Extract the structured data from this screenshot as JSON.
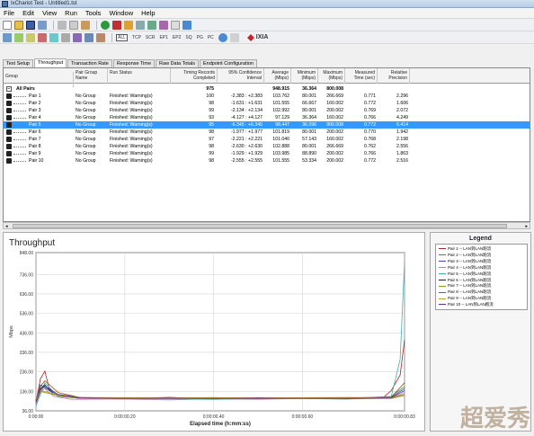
{
  "window": {
    "title": "IxChariot Test - Untitled1.tst"
  },
  "menu": [
    "File",
    "Edit",
    "View",
    "Run",
    "Tools",
    "Window",
    "Help"
  ],
  "toolbar2": {
    "protocols": [
      "ALL",
      "TCP",
      "SCR",
      "EP1",
      "EP2",
      "SQ",
      "PG",
      "PC"
    ],
    "brand": "IXIA"
  },
  "tabs": [
    "Test Setup",
    "Throughput",
    "Transaction Rate",
    "Response Time",
    "Raw Data Totals",
    "Endpoint Configuration"
  ],
  "grid": {
    "headers": {
      "group": "Group",
      "pair_group": "Pair Group Name",
      "run_status": "Run Status",
      "timing": "Timing Records Completed",
      "ci": "95% Confidence Interval",
      "avg": "Average (Mbps)",
      "min": "Minimum (Mbps)",
      "max": "Maximum (Mbps)",
      "time": "Measured Time (sec)",
      "precision": "Relative Precision"
    },
    "summary": {
      "label": "All Pairs",
      "timing": "975",
      "avg": "948.915",
      "min": "36.364",
      "max": "800.008"
    },
    "rows": [
      {
        "pair": "Pair 1",
        "group": "No Group",
        "status": "Finished: Warning(s)",
        "timing": "100",
        "ci": "-2.383 : +2.383",
        "avg": "103.762",
        "min": "80.001",
        "max": "266.669",
        "time": "0.771",
        "prec": "2.296"
      },
      {
        "pair": "Pair 2",
        "group": "No Group",
        "status": "Finished: Warning(s)",
        "timing": "98",
        "ci": "-1.631 : +1.631",
        "avg": "101.555",
        "min": "66.667",
        "max": "160.002",
        "time": "0.772",
        "prec": "1.606"
      },
      {
        "pair": "Pair 3",
        "group": "No Group",
        "status": "Finished: Warning(s)",
        "timing": "99",
        "ci": "-2.134 : +2.134",
        "avg": "102.992",
        "min": "80.001",
        "max": "200.002",
        "time": "0.769",
        "prec": "2.072"
      },
      {
        "pair": "Pair 4",
        "group": "No Group",
        "status": "Finished: Warning(s)",
        "timing": "93",
        "ci": "-4.127 : +4.127",
        "avg": "97.129",
        "min": "36.364",
        "max": "160.002",
        "time": "0.766",
        "prec": "4.249"
      },
      {
        "pair": "Pair 5",
        "group": "No Group",
        "status": "Finished: Warning(s)",
        "timing": "95",
        "ci": "-6.345 : +6.345",
        "avg": "98.447",
        "min": "36.096",
        "max": "800.008",
        "time": "0.772",
        "prec": "6.414"
      },
      {
        "pair": "Pair 6",
        "group": "No Group",
        "status": "Finished: Warning(s)",
        "timing": "98",
        "ci": "-1.977 : +1.977",
        "avg": "101.819",
        "min": "80.001",
        "max": "200.002",
        "time": "0.770",
        "prec": "1.942"
      },
      {
        "pair": "Pair 7",
        "group": "No Group",
        "status": "Finished: Warning(s)",
        "timing": "97",
        "ci": "-2.221 : +2.221",
        "avg": "101.040",
        "min": "57.143",
        "max": "160.002",
        "time": "0.768",
        "prec": "2.198"
      },
      {
        "pair": "Pair 8",
        "group": "No Group",
        "status": "Finished: Warning(s)",
        "timing": "98",
        "ci": "-2.630 : +2.630",
        "avg": "102.888",
        "min": "80.001",
        "max": "266.669",
        "time": "0.762",
        "prec": "2.556"
      },
      {
        "pair": "Pair 9",
        "group": "No Group",
        "status": "Finished: Warning(s)",
        "timing": "99",
        "ci": "-1.929 : +1.929",
        "avg": "103.985",
        "min": "88.890",
        "max": "200.002",
        "time": "0.766",
        "prec": "1.863"
      },
      {
        "pair": "Pair 10",
        "group": "No Group",
        "status": "Finished: Warning(s)",
        "timing": "98",
        "ci": "-2.555 : +2.555",
        "avg": "101.555",
        "min": "53.334",
        "max": "200.002",
        "time": "0.772",
        "prec": "2.516"
      }
    ],
    "selected_index": 4
  },
  "legend": {
    "title": "Legend",
    "items": [
      {
        "label": "Pair 1 -- LAN到LAN跑流",
        "color": "#b02020"
      },
      {
        "label": "Pair 2 -- LAN到LAN跑流",
        "color": "#20a040"
      },
      {
        "label": "Pair 3 -- LAN到LAN跑流",
        "color": "#3050c0"
      },
      {
        "label": "Pair 4 -- LAN到LAN跑流",
        "color": "#c080c0"
      },
      {
        "label": "Pair 5 -- LAN到LAN跑流",
        "color": "#40b0b0"
      },
      {
        "label": "Pair 6 -- LAN到LAN跑流",
        "color": "#202020"
      },
      {
        "label": "Pair 7 -- LAN到LAN跑流",
        "color": "#80a020"
      },
      {
        "label": "Pair 8 -- LAN到LAN跑流",
        "color": "#a05020"
      },
      {
        "label": "Pair 9 -- LAN到LAN跑流",
        "color": "#c0a020"
      },
      {
        "label": "Pair 10 -- LAN到LAN跑流",
        "color": "#6a2a9a"
      }
    ]
  },
  "chart_data": {
    "type": "line",
    "title": "Throughput",
    "xlabel": "Elapsed time (h:mm:ss)",
    "ylabel": "Mbps",
    "ylim": [
      36.0,
      848.0
    ],
    "yticks": [
      "36.00",
      "136.00",
      "236.00",
      "336.00",
      "436.00",
      "536.00",
      "636.00",
      "736.00",
      "848.00"
    ],
    "ytick_values": [
      36,
      136,
      236,
      336,
      436,
      536,
      636,
      736,
      848
    ],
    "xticks": [
      "0:00:00",
      "0:00:00.20",
      "0:00:00.40",
      "0:00:00.60",
      "0:00:00.83"
    ],
    "xtick_values": [
      0,
      0.2,
      0.4,
      0.6,
      0.83
    ],
    "xlim": [
      0,
      0.83
    ],
    "grid": true,
    "series": [
      {
        "name": "Pair 1 -- LAN到LAN跑流",
        "color": "#b02020",
        "x": [
          0,
          0.01,
          0.02,
          0.03,
          0.05,
          0.1,
          0.2,
          0.3,
          0.4,
          0.5,
          0.6,
          0.7,
          0.78,
          0.8,
          0.82,
          0.83
        ],
        "y": [
          80,
          200,
          240,
          150,
          110,
          100,
          100,
          105,
          98,
          102,
          100,
          99,
          100,
          140,
          220,
          400
        ]
      },
      {
        "name": "Pair 2 -- LAN到LAN跑流",
        "color": "#20a040",
        "x": [
          0,
          0.01,
          0.02,
          0.04,
          0.06,
          0.1,
          0.2,
          0.3,
          0.4,
          0.5,
          0.6,
          0.7,
          0.8,
          0.83
        ],
        "y": [
          80,
          140,
          160,
          130,
          110,
          100,
          97,
          104,
          101,
          99,
          103,
          100,
          110,
          160
        ]
      },
      {
        "name": "Pair 3 -- LAN到LAN跑流",
        "color": "#3050c0",
        "x": [
          0,
          0.01,
          0.03,
          0.05,
          0.1,
          0.2,
          0.3,
          0.4,
          0.5,
          0.6,
          0.7,
          0.8,
          0.83
        ],
        "y": [
          90,
          170,
          140,
          120,
          105,
          100,
          102,
          99,
          104,
          100,
          98,
          105,
          150
        ]
      },
      {
        "name": "Pair 4 -- LAN到LAN跑流",
        "color": "#c080c0",
        "x": [
          0,
          0.01,
          0.02,
          0.04,
          0.08,
          0.2,
          0.3,
          0.4,
          0.5,
          0.6,
          0.7,
          0.8,
          0.83
        ],
        "y": [
          70,
          130,
          150,
          110,
          95,
          96,
          92,
          98,
          95,
          99,
          97,
          100,
          130
        ]
      },
      {
        "name": "Pair 5 -- LAN到LAN跑流",
        "color": "#40b0b0",
        "x": [
          0,
          0.01,
          0.02,
          0.05,
          0.1,
          0.2,
          0.3,
          0.4,
          0.5,
          0.6,
          0.7,
          0.8,
          0.82,
          0.83
        ],
        "y": [
          60,
          120,
          180,
          110,
          100,
          98,
          97,
          95,
          98,
          99,
          96,
          110,
          300,
          800
        ]
      },
      {
        "name": "Pair 6 -- LAN到LAN跑流",
        "color": "#202020",
        "x": [
          0,
          0.01,
          0.02,
          0.04,
          0.1,
          0.2,
          0.3,
          0.4,
          0.5,
          0.6,
          0.7,
          0.8,
          0.83
        ],
        "y": [
          90,
          150,
          170,
          120,
          104,
          101,
          100,
          103,
          100,
          102,
          101,
          104,
          120
        ]
      },
      {
        "name": "Pair 7 -- LAN到LAN跑流",
        "color": "#80a020",
        "x": [
          0,
          0.01,
          0.03,
          0.06,
          0.1,
          0.2,
          0.3,
          0.4,
          0.5,
          0.6,
          0.7,
          0.8,
          0.83
        ],
        "y": [
          75,
          135,
          125,
          108,
          100,
          102,
          99,
          101,
          98,
          100,
          102,
          99,
          115
        ]
      },
      {
        "name": "Pair 8 -- LAN到LAN跑流",
        "color": "#a05020",
        "x": [
          0,
          0.01,
          0.02,
          0.05,
          0.1,
          0.2,
          0.3,
          0.4,
          0.5,
          0.6,
          0.7,
          0.8,
          0.83
        ],
        "y": [
          85,
          160,
          190,
          130,
          104,
          103,
          102,
          104,
          101,
          103,
          102,
          106,
          180
        ]
      },
      {
        "name": "Pair 9 -- LAN到LAN跑流",
        "color": "#c0a020",
        "x": [
          0,
          0.01,
          0.03,
          0.06,
          0.1,
          0.2,
          0.3,
          0.4,
          0.5,
          0.6,
          0.7,
          0.8,
          0.83
        ],
        "y": [
          95,
          140,
          130,
          112,
          105,
          104,
          103,
          104,
          103,
          104,
          105,
          104,
          120
        ]
      },
      {
        "name": "Pair 10 -- LAN到LAN跑流",
        "color": "#6a2a9a",
        "x": [
          0,
          0.01,
          0.02,
          0.05,
          0.1,
          0.2,
          0.3,
          0.4,
          0.5,
          0.6,
          0.7,
          0.8,
          0.83
        ],
        "y": [
          80,
          145,
          165,
          120,
          102,
          100,
          101,
          99,
          101,
          100,
          99,
          103,
          140
        ]
      }
    ]
  },
  "watermark": "超爱秀"
}
